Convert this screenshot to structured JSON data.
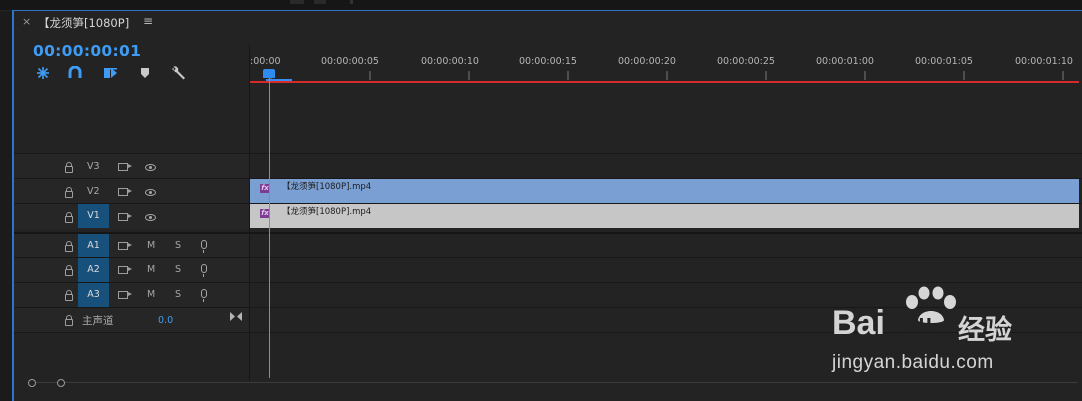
{
  "sequence_tab": {
    "close_glyph": "×",
    "title": "【龙须笋[1080P]",
    "menu_glyph": "≡"
  },
  "timecode": "00:00:00:01",
  "toolbar": [
    {
      "icon": "snap-icon"
    },
    {
      "icon": "linked-selection-icon"
    },
    {
      "icon": "add-edit-icon"
    },
    {
      "icon": "marker-icon"
    },
    {
      "icon": "wrench-icon"
    }
  ],
  "ruler": {
    "labels": [
      ":00:00",
      "00:00:00:05",
      "00:00:00:10",
      "00:00:00:15",
      "00:00:00:20",
      "00:00:00:25",
      "00:00:01:00",
      "00:00:01:05",
      "00:00:01:10"
    ],
    "playhead_timecode": "00:00:00:01"
  },
  "video_tracks": [
    {
      "name": "V3",
      "targeted": false
    },
    {
      "name": "V2",
      "targeted": false,
      "clip": "【龙须笋[1080P].mp4",
      "clip_color": "#7a9fd3"
    },
    {
      "name": "V1",
      "targeted": true,
      "clip": "【龙须笋[1080P].mp4",
      "clip_color": "#c6c6c6"
    }
  ],
  "audio_tracks": [
    {
      "name": "A1",
      "mute": "M",
      "solo": "S"
    },
    {
      "name": "A2",
      "mute": "M",
      "solo": "S"
    },
    {
      "name": "A3",
      "mute": "M",
      "solo": "S"
    }
  ],
  "master": {
    "label": "主声道",
    "value": "0.0"
  },
  "watermark": {
    "brand": "Bai",
    "brand2": "du",
    "cn": "经验",
    "url": "jingyan.baidu.com"
  },
  "colors": {
    "accent": "#3f9cf5",
    "track_target": "#17507a",
    "in_out_line": "#d42c2c"
  }
}
